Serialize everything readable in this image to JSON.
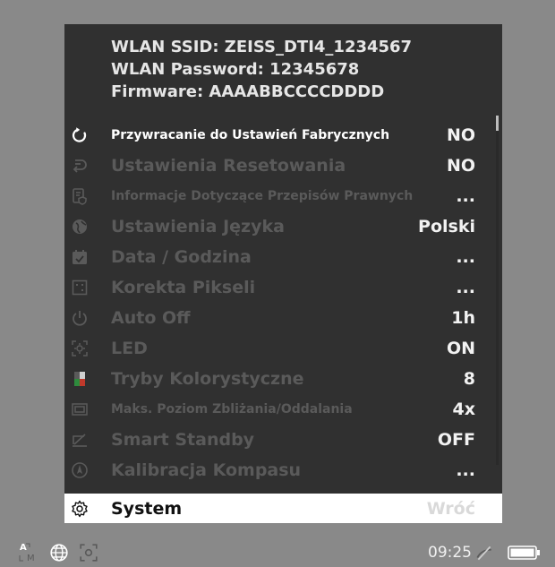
{
  "info": {
    "ssid": "WLAN SSID: ZEISS_DTI4_1234567",
    "password": "WLAN Password: 12345678",
    "firmware": "Firmware: AAAABBCCCCDDDD"
  },
  "menu": [
    {
      "icon": "reset-arrow-icon",
      "label": "Przywracanie do Ustawień Fabrycznych",
      "value": "NO"
    },
    {
      "icon": "undo-icon",
      "label": "Ustawienia Resetowania",
      "value": "NO"
    },
    {
      "icon": "document-shield-icon",
      "label": "Informacje Dotyczące Przepisów Prawnych",
      "value": "..."
    },
    {
      "icon": "globe-icon",
      "label": "Ustawienia Języka",
      "value": "Polski"
    },
    {
      "icon": "calendar-icon",
      "label": "Data / Godzina",
      "value": "..."
    },
    {
      "icon": "pixel-grid-icon",
      "label": "Korekta Pikseli",
      "value": "..."
    },
    {
      "icon": "power-icon",
      "label": "Auto Off",
      "value": "1h"
    },
    {
      "icon": "led-icon",
      "label": "LED",
      "value": "ON"
    },
    {
      "icon": "color-modes-icon",
      "label": "Tryby Kolorystyczne",
      "value": "8"
    },
    {
      "icon": "zoom-frame-icon",
      "label": "Maks. Poziom Zbliżania/Oddalania",
      "value": "4x"
    },
    {
      "icon": "standby-icon",
      "label": "Smart Standby",
      "value": "OFF"
    },
    {
      "icon": "compass-icon",
      "label": "Kalibracja Kompasu",
      "value": "..."
    },
    {
      "icon": "gear-icon",
      "label": "System",
      "value": "Wróć"
    }
  ],
  "status": {
    "auto_mode_letter_top": "A",
    "auto_mode_letter_bottom": "M",
    "time": "09:25",
    "battery_level": 1.0
  },
  "colors": {
    "background": "#898989",
    "panel": "#303030",
    "selected_row": "#ffffff",
    "dim_text": "#5a5a5a"
  }
}
